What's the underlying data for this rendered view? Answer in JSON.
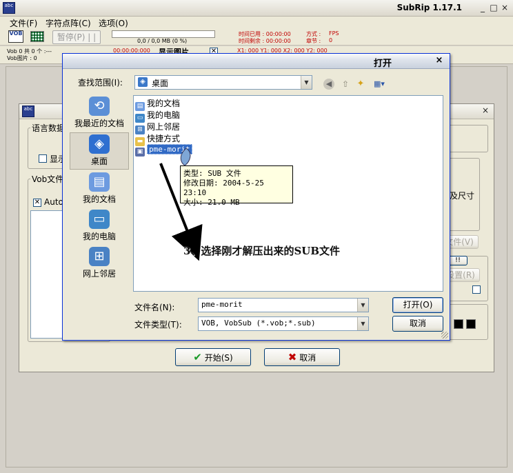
{
  "main_window": {
    "title": "SubRip 1.17.1",
    "minimize": "_",
    "maximize": "□",
    "close": "×",
    "app_icon_text": "abc"
  },
  "menu": {
    "items": [
      "文件(F)",
      "字符点阵(C)",
      "选项(O)"
    ]
  },
  "toolbar": {
    "vob_icon_text": "VOB",
    "pause_label": "暂停(P) | |",
    "progress_text": "0,0 / 0,0 MB (0 %)",
    "time_used_label": "时间已用 : 00:00:00",
    "time_left_label": "时间剩余 : 00:00:00",
    "mode_label": "方式 :",
    "mode_value": "FPS",
    "chapter_label": "章节 :",
    "chapter_value": "0"
  },
  "infobar": {
    "vob_count": "Vob 0  共 0 个 :---",
    "vob_image": "Vob图片 : 0",
    "timecode": "00:00:00:000",
    "show_image": "显示图片",
    "coords": "X1: 000  Y1: 000  X2: 000  Y2: 000"
  },
  "bg_dialog": {
    "icon_text": "abc",
    "close": "×",
    "lang_group": "语言数据",
    "show_checkbox": "显示",
    "vob_files_group": "Vob文件",
    "autos_checkbox": "Autos",
    "size_text": "及尺寸",
    "file_btn": "文件(V)",
    "exclaim_btn": "!!",
    "set_btn": "设置(R)",
    "start_button": "开始(S)",
    "cancel_button": "取消"
  },
  "open_dialog": {
    "title": "打开",
    "close": "×",
    "look_in_label": "查找范围(I):",
    "look_in_value": "桌面",
    "places": [
      "我最近的文档",
      "桌面",
      "我的文档",
      "我的电脑",
      "网上邻居"
    ],
    "files": [
      "我的文档",
      "我的电脑",
      "网上邻居",
      "快捷方式",
      "pme-morit"
    ],
    "tooltip": {
      "type": "类型: SUB 文件",
      "modified": "修改日期: 2004-5-25 23:10",
      "size": "大小: 21.0 MB"
    },
    "filename_label": "文件名(N):",
    "filename_value": "pme-morit",
    "filetype_label": "文件类型(T):",
    "filetype_value": "VOB, VobSub (*.vob;*.sub)",
    "open_button": "打开(O)",
    "cancel_button": "取消"
  },
  "annotation": "3、选择刚才解压出来的SUB文件"
}
